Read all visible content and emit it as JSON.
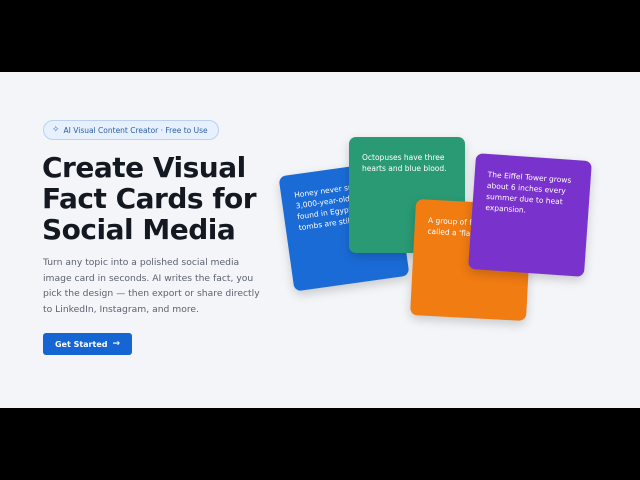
{
  "hero": {
    "badge": {
      "icon": "sparkle-icon",
      "label": "AI Visual Content Creator · Free to Use"
    },
    "title": "Create Visual Fact Cards for Social Media",
    "description": "Turn any topic into a polished social media image card in seconds. AI writes the fact, you pick the design — then export or share directly to LinkedIn, Instagram, and more.",
    "cta": {
      "label": "Get Started",
      "icon": "arrow-right-icon"
    }
  },
  "cards": [
    {
      "id": "blue",
      "color": "#1b6bd6",
      "text": "Honey never spoils. 3,000-year-old honey found in Egyptian tombs are still edible."
    },
    {
      "id": "green",
      "color": "#2a9a74",
      "text": "Octopuses have three hearts and blue blood."
    },
    {
      "id": "orange",
      "color": "#f07c12",
      "text": "A group of flamingos is called a 'flamboyance'."
    },
    {
      "id": "purple",
      "color": "#7a32cc",
      "text": "The Eiffel Tower grows about 6 inches every summer due to heat expansion."
    }
  ],
  "colors": {
    "accent": "#1565d2",
    "background": "#f3f5f8",
    "title": "#141820"
  }
}
